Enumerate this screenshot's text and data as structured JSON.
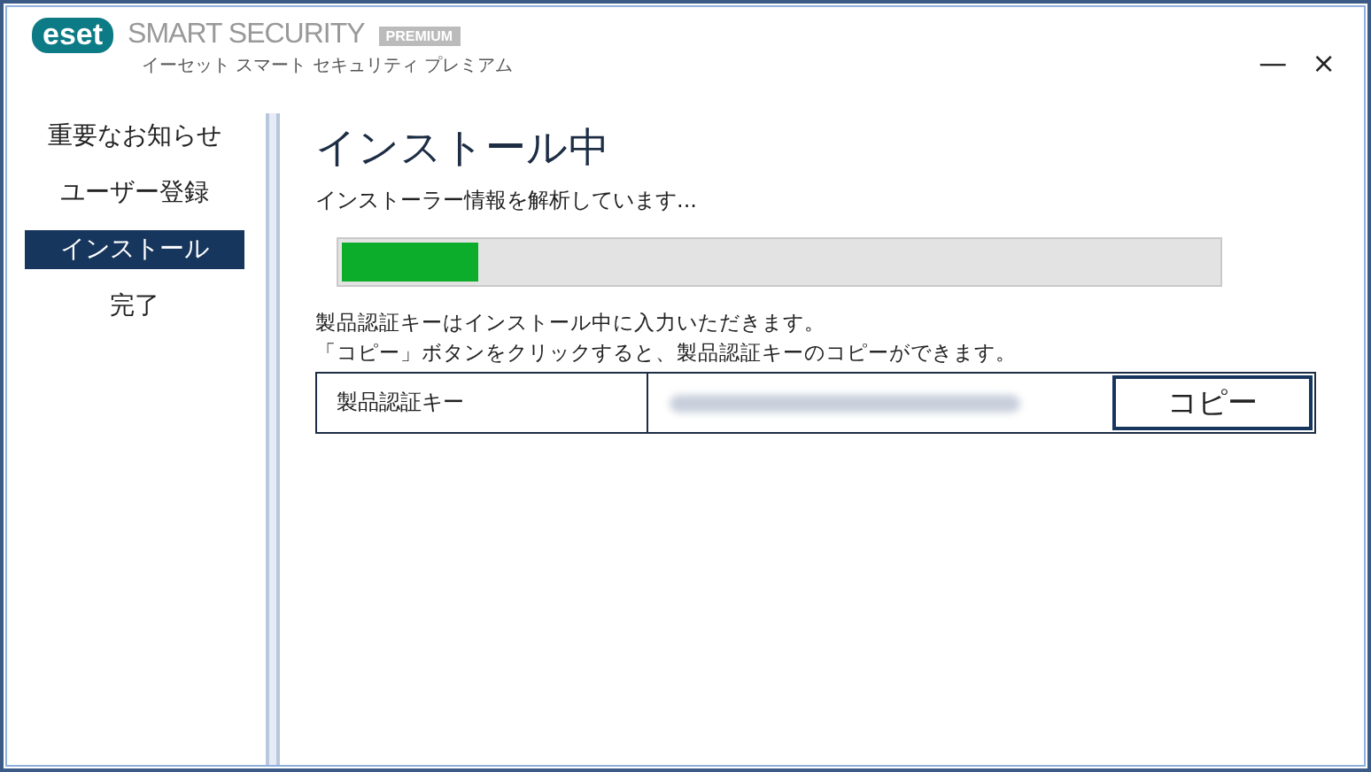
{
  "header": {
    "logo": "eset",
    "product": "SMART SECURITY",
    "edition": "PREMIUM",
    "subtitle": "イーセット スマート セキュリティ プレミアム",
    "controls": [
      "—",
      "×"
    ]
  },
  "sidebar": {
    "items": [
      {
        "label": "重要なお知らせ",
        "selected": false
      },
      {
        "label": "ユーザー登録",
        "selected": false
      },
      {
        "label": "インストール",
        "selected": true
      },
      {
        "label": "完了",
        "selected": false
      }
    ]
  },
  "main": {
    "title": "インストール中",
    "status": "インストーラー情報を解析しています...",
    "progress": {
      "level": 0.155
    },
    "notes": [
      "製品認証キーはインストール中に入力いただきます。",
      "「コピー」ボタンをクリックすると、製品認証キーのコピーができます。"
    ],
    "key_row": {
      "label": "製品認証キー",
      "button": "コピー"
    }
  }
}
